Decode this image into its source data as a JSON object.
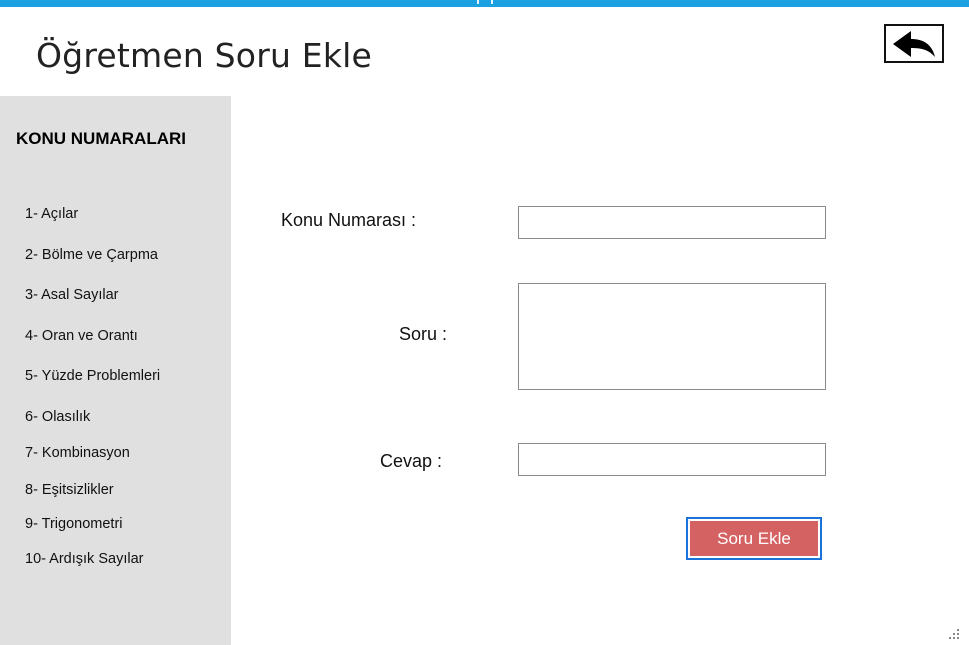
{
  "header": {
    "title": "Öğretmen Soru Ekle",
    "back_icon": "back-arrow-icon"
  },
  "sidebar": {
    "heading": "KONU NUMARALARI",
    "items": [
      {
        "label": "1- Açılar"
      },
      {
        "label": "2- Bölme ve Çarpma"
      },
      {
        "label": "3- Asal Sayılar"
      },
      {
        "label": "4- Oran ve Orantı"
      },
      {
        "label": "5- Yüzde Problemleri"
      },
      {
        "label": "6- Olasılık"
      },
      {
        "label": "7- Kombinasyon"
      },
      {
        "label": "8- Eşitsizlikler"
      },
      {
        "label": "9- Trigonometri"
      },
      {
        "label": "10- Ardışık Sayılar"
      }
    ]
  },
  "form": {
    "topic_label": "Konu Numarası :",
    "topic_value": "",
    "question_label": "Soru :",
    "question_value": "",
    "answer_label": "Cevap :",
    "answer_value": "",
    "submit_label": "Soru Ekle"
  },
  "colors": {
    "title_bar": "#1ba1e2",
    "sidebar_bg": "#e0e0e0",
    "submit_bg": "#d46262",
    "submit_border": "#1b72d9"
  }
}
